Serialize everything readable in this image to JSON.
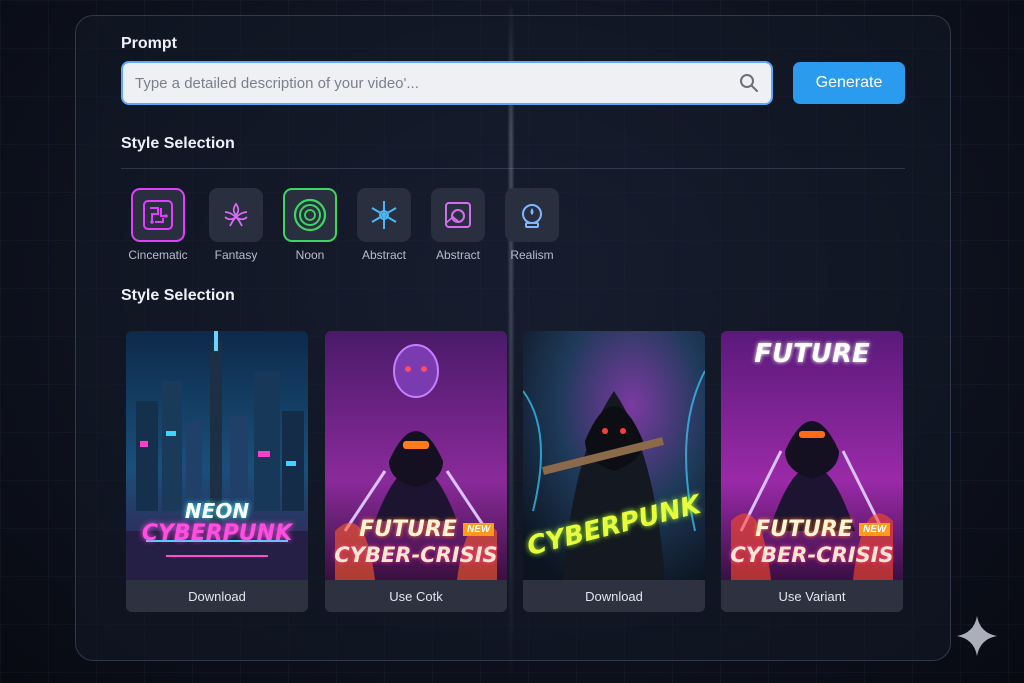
{
  "prompt": {
    "label": "Prompt",
    "placeholder": "Type a detailed description of your video'...",
    "generate_label": "Generate"
  },
  "style_selection": {
    "label": "Style Selection",
    "items": [
      {
        "label": "Cincematic",
        "icon": "circuit-icon",
        "color": "#e040fb"
      },
      {
        "label": "Fantasy",
        "icon": "flower-icon",
        "color": "#d86bf5"
      },
      {
        "label": "Noon",
        "icon": "rings-icon",
        "color": "#3cd664"
      },
      {
        "label": "Abstract",
        "icon": "snowflake-icon",
        "color": "#4fb6f5"
      },
      {
        "label": "Abstract",
        "icon": "frame-icon",
        "color": "#d86bf5"
      },
      {
        "label": "Realism",
        "icon": "lamp-icon",
        "color": "#7fb8ff"
      }
    ]
  },
  "results": {
    "label": "Style Selection",
    "cards": [
      {
        "title_top": "NEON",
        "title_bottom": "CYBERPUNK",
        "button": "Download"
      },
      {
        "title_top": "FUTURE",
        "badge": "NEW",
        "title_bottom": "CYBER-CRISIS",
        "button": "Use Cotk"
      },
      {
        "title_top": "CYBERPUNK",
        "button": "Download"
      },
      {
        "title_top": "FUTURE",
        "title_mid": "FUTURE",
        "badge": "NEW",
        "title_bottom": "CYBER-CRISIS",
        "button": "Use Variant"
      }
    ]
  }
}
